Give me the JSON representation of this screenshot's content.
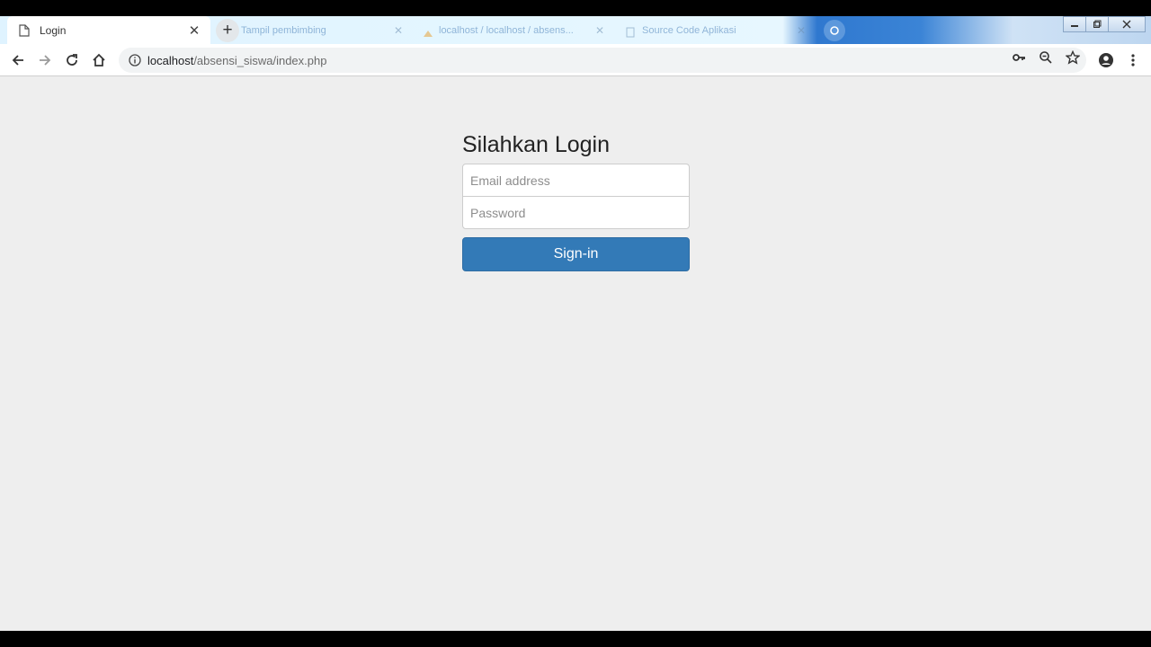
{
  "browser": {
    "active_tab": {
      "title": "Login",
      "favicon": "page-icon"
    },
    "background_tabs": [
      {
        "title": "Tampil pembimbing"
      },
      {
        "title": "localhost / localhost / absens..."
      },
      {
        "title": "Source Code Aplikasi"
      }
    ],
    "new_tab_symbol": "+",
    "url": {
      "host": "localhost",
      "path": "/absensi_siswa/index.php"
    },
    "icons": [
      "back-icon",
      "forward-icon",
      "reload-icon",
      "home-icon",
      "info-icon",
      "key-icon",
      "zoom-icon",
      "star-icon",
      "account-icon",
      "menu-icon"
    ]
  },
  "login": {
    "heading": "Silahkan Login",
    "email_placeholder": "Email address",
    "password_placeholder": "Password",
    "submit_label": "Sign-in"
  },
  "colors": {
    "button_primary": "#337ab7",
    "page_background": "#eeeeee"
  }
}
